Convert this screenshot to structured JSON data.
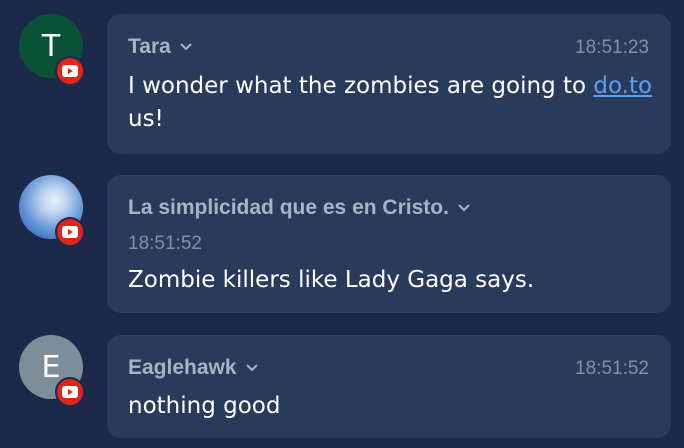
{
  "messages": [
    {
      "avatar_initial": "T",
      "avatar_color": "#0b5138",
      "author": "Tara",
      "time": "18:51:23",
      "text_before": "I wonder what the zombies are going to",
      "link": "do.to",
      "text_after": " us!",
      "platform_icon": "youtube-icon"
    },
    {
      "avatar_initial": "",
      "author": "La simplicidad que es en Cristo.",
      "time": "18:51:52",
      "text": "Zombie killers like Lady Gaga says.",
      "platform_icon": "youtube-icon"
    },
    {
      "avatar_initial": "E",
      "avatar_color": "#7d8e9a",
      "author": "Eaglehawk",
      "time": "18:51:52",
      "text": "nothing good",
      "platform_icon": "youtube-icon"
    }
  ],
  "colors": {
    "background": "#1b2a4a",
    "bubble": "#2a3a5b",
    "author": "#aab3c5",
    "time": "#8690a4",
    "link": "#5aa0f2",
    "badge": "#e1251b"
  },
  "icons": {
    "chevron": "chevron-down-icon",
    "platform": "youtube-icon"
  }
}
